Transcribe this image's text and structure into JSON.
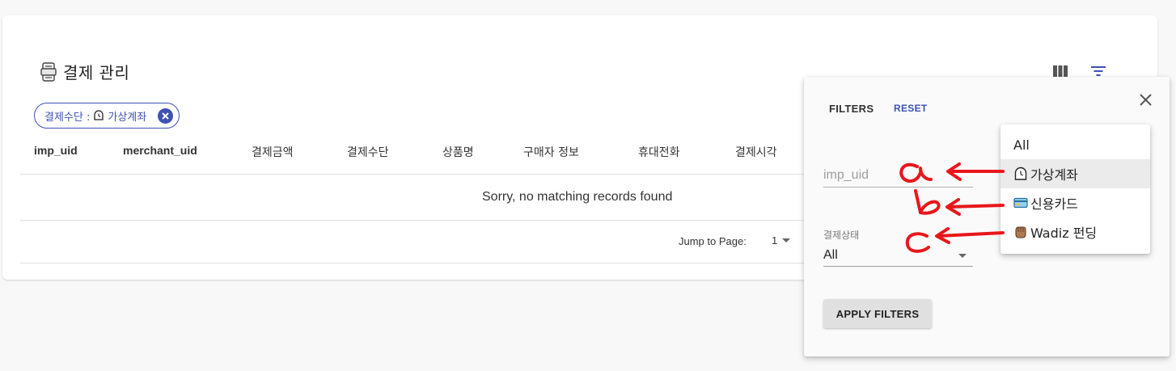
{
  "header": {
    "title": "결제 관리",
    "icon": "receipt-icon"
  },
  "toolbar": {
    "columns_icon": "view-column-icon",
    "filter_icon": "filter-list-icon"
  },
  "chips": [
    {
      "label": "결제수단 : ",
      "value": "가상계좌",
      "value_icon": "clock-icon"
    }
  ],
  "table": {
    "columns": [
      "imp_uid",
      "merchant_uid",
      "결제금액",
      "결제수단",
      "상품명",
      "구매자 정보",
      "휴대전화",
      "결제시각"
    ],
    "empty_message": "Sorry, no matching records found"
  },
  "pagination": {
    "jump_label": "Jump to Page:",
    "page": "1"
  },
  "filters": {
    "title": "FILTERS",
    "reset_label": "RESET",
    "imp_uid_placeholder": "imp_uid",
    "status_label": "결제상태",
    "status_value": "All",
    "apply_label": "APPLY FILTERS"
  },
  "payment_method_options": [
    {
      "label": "All",
      "icon": ""
    },
    {
      "label": "가상계좌",
      "icon": "clock-icon",
      "selected": true
    },
    {
      "label": "신용카드",
      "icon": "credit-card-icon"
    },
    {
      "label": "Wadiz 펀딩",
      "icon": "hand-icon"
    }
  ],
  "annotations": [
    "a",
    "b",
    "c"
  ],
  "colors": {
    "primary": "#3f51b5",
    "annotation": "#e8161b"
  }
}
